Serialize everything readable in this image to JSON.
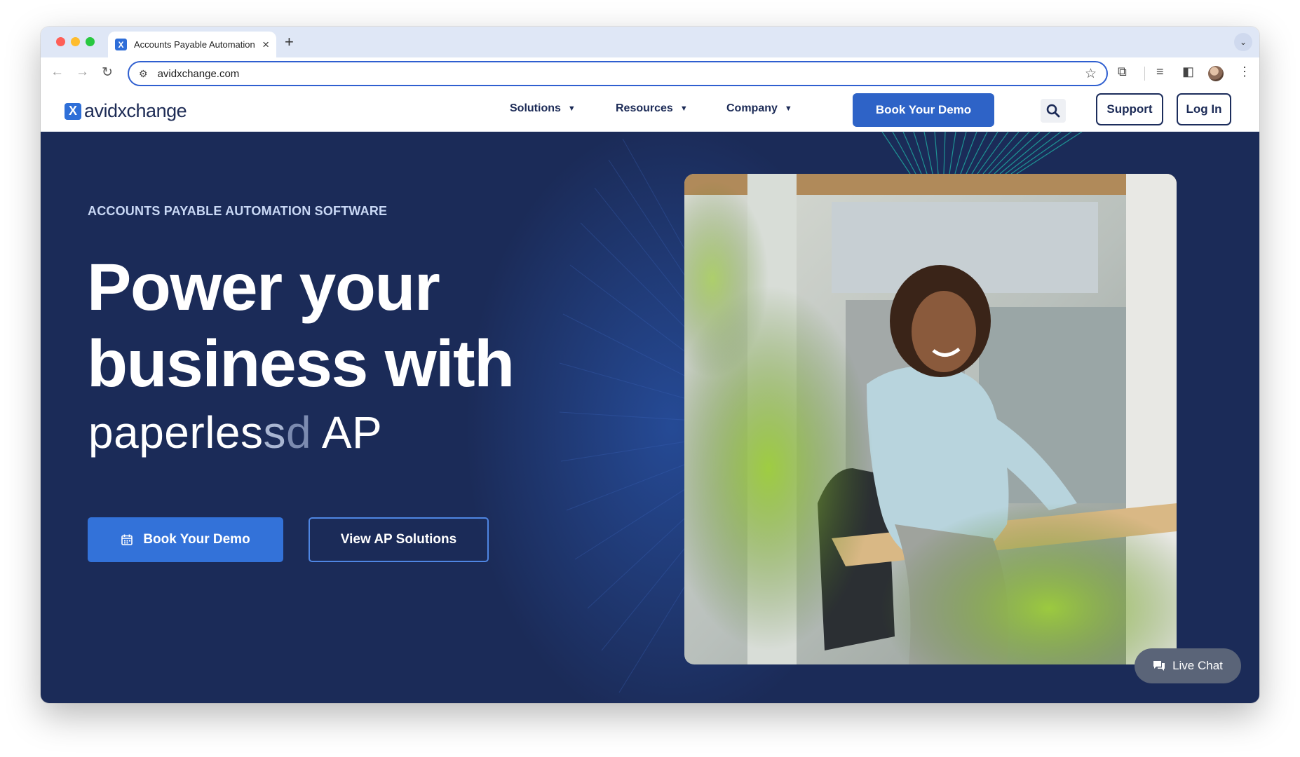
{
  "browser": {
    "tab_title": "Accounts Payable Automation",
    "tab_favicon": "X",
    "url": "avidxchange.com"
  },
  "header": {
    "logo_text": "avidxchange",
    "nav": [
      {
        "label": "Solutions"
      },
      {
        "label": "Resources"
      },
      {
        "label": "Company"
      }
    ],
    "book_demo": "Book Your Demo",
    "support": "Support",
    "login": "Log In"
  },
  "hero": {
    "eyebrow": "ACCOUNTS PAYABLE AUTOMATION SOFTWARE",
    "headline": "Power your business with",
    "subline_main": "paperles",
    "subline_fade1": "s",
    "subline_fade2": "d",
    "subline_end": " AP",
    "cta_primary": "Book Your Demo",
    "cta_secondary": "View AP Solutions"
  },
  "chat": {
    "label": "Live Chat"
  },
  "icons": [
    "close-icon",
    "plus-icon",
    "chevron-down-icon",
    "back-arrow-icon",
    "forward-arrow-icon",
    "reload-icon",
    "site-info-icon",
    "star-icon",
    "extensions-icon",
    "media-icon",
    "side-panel-icon",
    "profile-avatar",
    "more-vert-icon",
    "search-icon",
    "calendar-icon",
    "chat-icon"
  ],
  "colors": {
    "brand_blue": "#2e63c7",
    "navy": "#1b2b58",
    "header_text": "#1b2a56"
  }
}
